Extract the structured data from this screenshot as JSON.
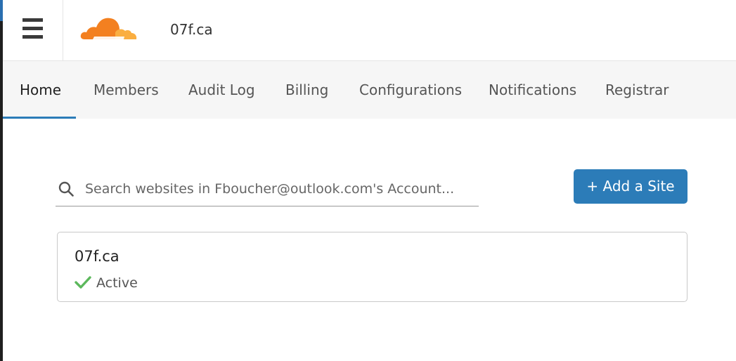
{
  "header": {
    "menu_icon": "hamburger-menu-icon",
    "logo_icon": "cloud-logo-icon",
    "site_title": "07f.ca"
  },
  "nav": {
    "tabs": [
      {
        "label": "Home",
        "active": true
      },
      {
        "label": "Members",
        "active": false
      },
      {
        "label": "Audit Log",
        "active": false
      },
      {
        "label": "Billing",
        "active": false
      },
      {
        "label": "Configurations",
        "active": false
      },
      {
        "label": "Notifications",
        "active": false
      },
      {
        "label": "Registrar",
        "active": false
      }
    ]
  },
  "search": {
    "placeholder": "Search websites in Fboucher@outlook.com's Account...",
    "value": "",
    "icon": "search-icon"
  },
  "actions": {
    "add_site_label": "+ Add a Site"
  },
  "sites": [
    {
      "name": "07f.ca",
      "status": "Active",
      "status_icon": "check-icon"
    }
  ],
  "colors": {
    "accent": "#2c7cb8",
    "logo_orange": "#f38020",
    "logo_light_orange": "#faae40",
    "status_green": "#5cb85c",
    "nav_bg": "#f6f6f6"
  }
}
